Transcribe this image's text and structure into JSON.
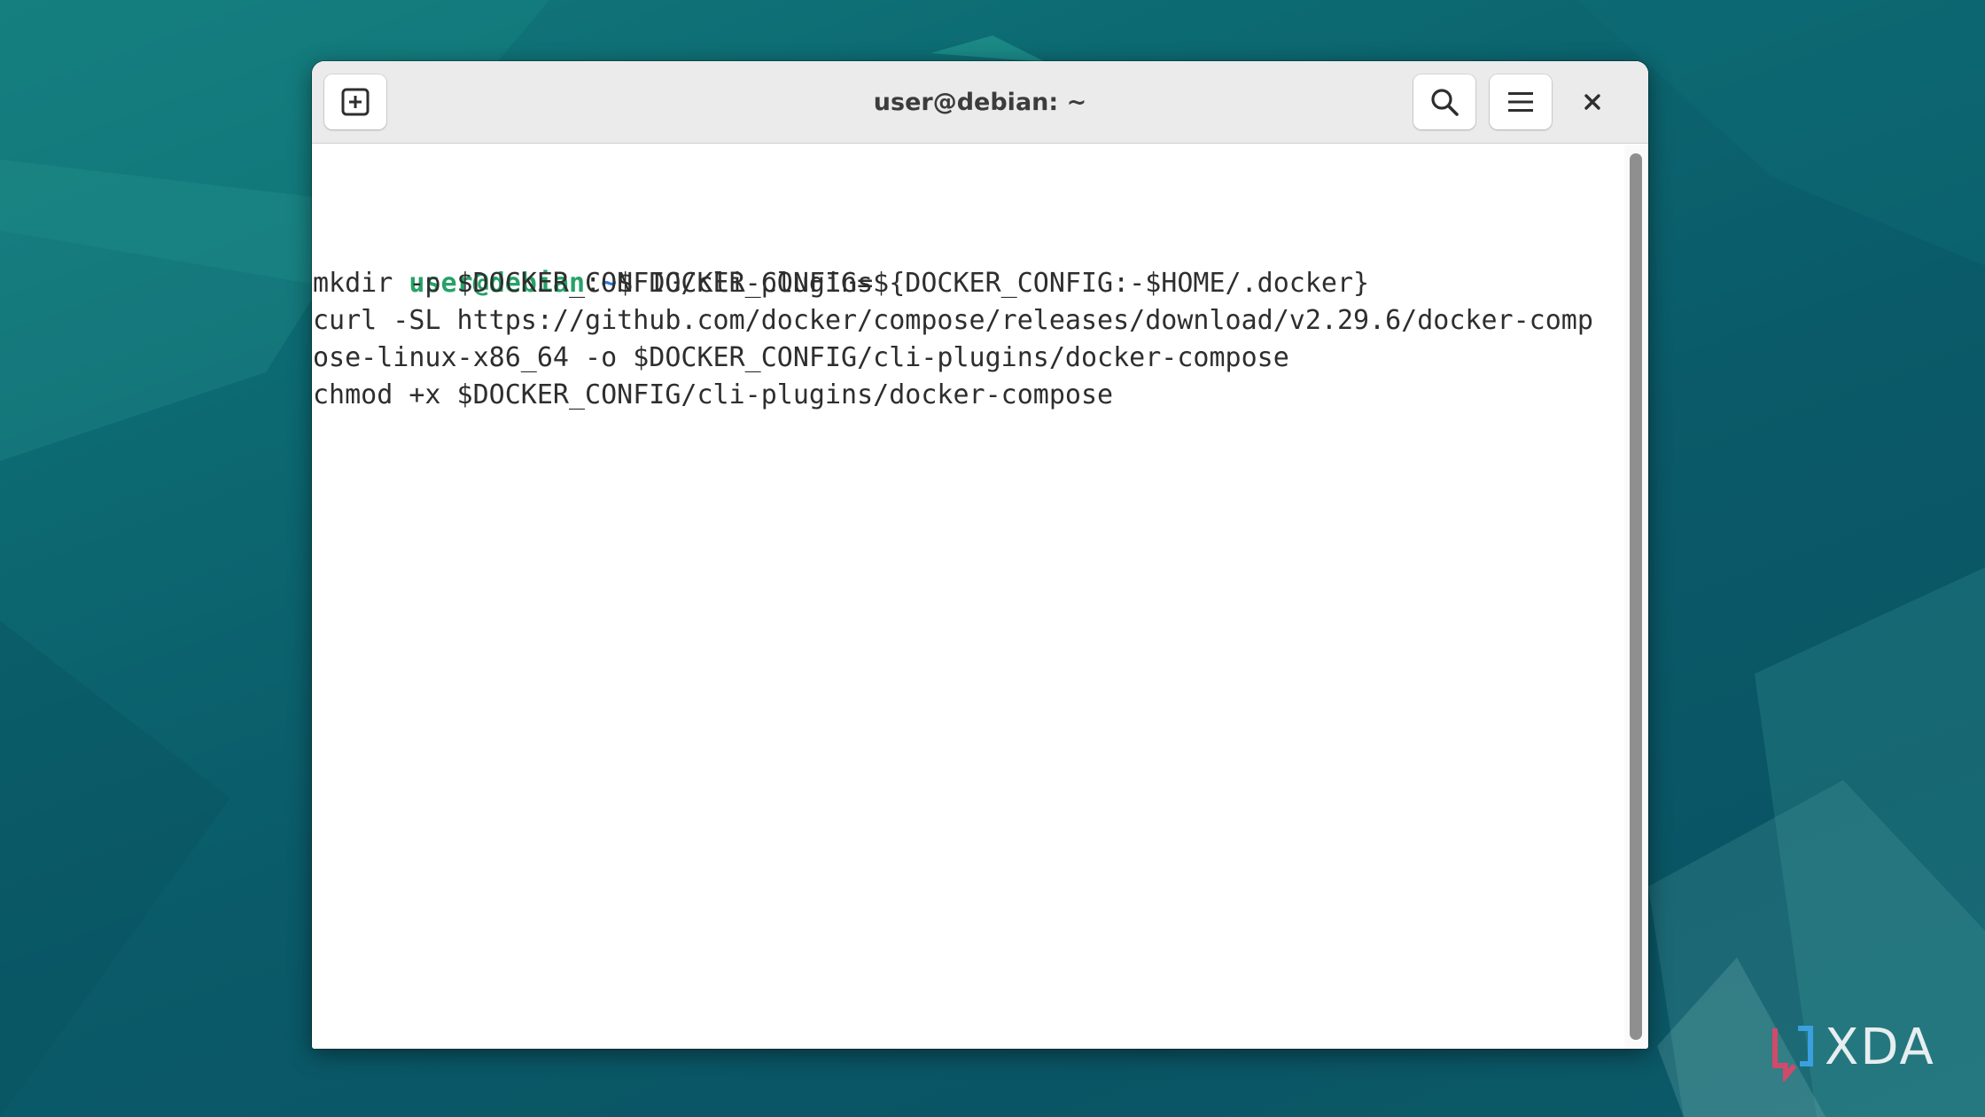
{
  "desktop": {
    "background_color": "#0b5e6b"
  },
  "window": {
    "title": "user@debian: ~",
    "new_tab_icon": "new-tab-icon",
    "search_icon": "search-icon",
    "menu_icon": "hamburger-menu-icon",
    "close_icon": "close-icon"
  },
  "terminal": {
    "prompt_user": "user@debian",
    "prompt_sep": ":",
    "prompt_path": "~",
    "prompt_symbol": "$ ",
    "lines": [
      "DOCKER_CONFIG=${DOCKER_CONFIG:-$HOME/.docker}",
      "mkdir -p $DOCKER_CONFIG/cli-plugins",
      "curl -SL https://github.com/docker/compose/releases/download/v2.29.6/docker-comp",
      "ose-linux-x86_64 -o $DOCKER_CONFIG/cli-plugins/docker-compose",
      "chmod +x $DOCKER_CONFIG/cli-plugins/docker-compose"
    ],
    "colors": {
      "user": "#26a269",
      "path": "#2a7bde",
      "text": "#2e2e2e"
    }
  },
  "watermark": {
    "text": "XDA"
  }
}
